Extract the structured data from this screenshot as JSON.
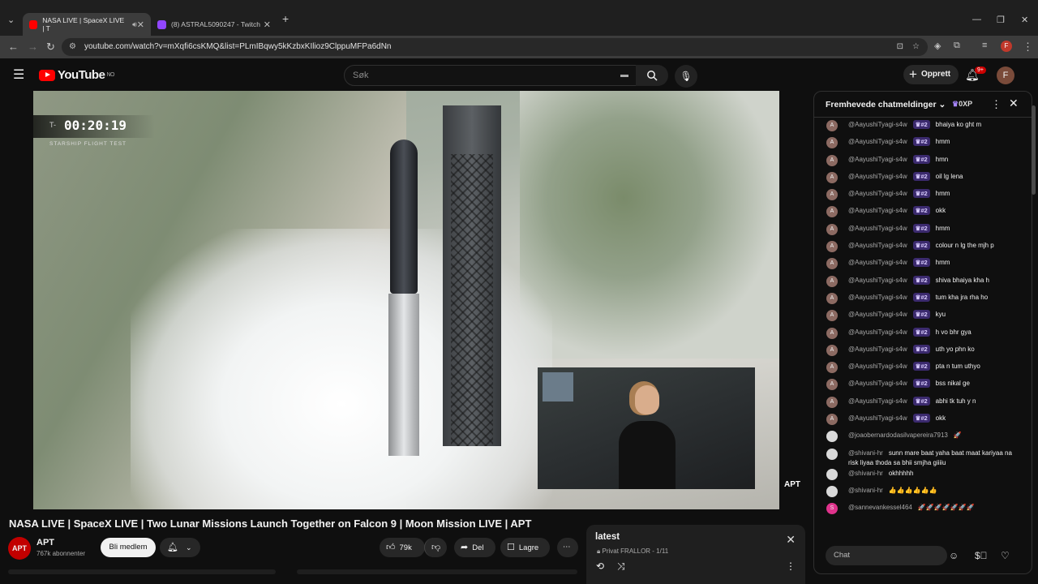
{
  "browser": {
    "tabs": [
      {
        "label": "NASA LIVE | SpaceX LIVE | T"
      },
      {
        "label": "(8) ASTRAL5090247 - Twitch"
      }
    ],
    "url": "youtube.com/watch?v=mXqfi6csKMQ&list=PLmIBqwy5kKzbxKIlioz9ClppuMFPa6dNn"
  },
  "yt": {
    "logo_text": "YouTube",
    "region": "NO",
    "search_placeholder": "Søk",
    "create_label": "Opprett",
    "notif_count": "9+",
    "account_initial": "F"
  },
  "video": {
    "timer_prefix": "T-",
    "timer_value": "00:20:19",
    "timer_sub": "STARSHIP FLIGHT TEST",
    "watermark": "APT",
    "title": "NASA LIVE | SpaceX LIVE | Two Lunar Missions Launch Together on Falcon 9 | Moon Mission LIVE | APT"
  },
  "channel": {
    "avatar_text": "APT",
    "name": "APT",
    "subscribers": "767k abonnenter",
    "join_label": "Bli medlem"
  },
  "actions": {
    "likes": "79k",
    "share": "Del",
    "save": "Lagre"
  },
  "playlist": {
    "title": "latest",
    "subtitle": "Privat FRALLOR - 1/11"
  },
  "chat": {
    "header": "Fremhevede chatmeldinger",
    "xp": "0XP",
    "input_placeholder": "Chat",
    "messages": [
      {
        "av": "A",
        "author": "@AayushiTyagi-s4w",
        "badge": "#2",
        "text": "bhaiya ko ght m"
      },
      {
        "av": "A",
        "author": "@AayushiTyagi-s4w",
        "badge": "#2",
        "text": "hmm"
      },
      {
        "av": "A",
        "author": "@AayushiTyagi-s4w",
        "badge": "#2",
        "text": "hmn"
      },
      {
        "av": "A",
        "author": "@AayushiTyagi-s4w",
        "badge": "#2",
        "text": "oil lg lena"
      },
      {
        "av": "A",
        "author": "@AayushiTyagi-s4w",
        "badge": "#2",
        "text": "hmm"
      },
      {
        "av": "A",
        "author": "@AayushiTyagi-s4w",
        "badge": "#2",
        "text": "okk"
      },
      {
        "av": "A",
        "author": "@AayushiTyagi-s4w",
        "badge": "#2",
        "text": "hmm"
      },
      {
        "av": "A",
        "author": "@AayushiTyagi-s4w",
        "badge": "#2",
        "text": "colour n lg the mjh p"
      },
      {
        "av": "A",
        "author": "@AayushiTyagi-s4w",
        "badge": "#2",
        "text": "hmm"
      },
      {
        "av": "A",
        "author": "@AayushiTyagi-s4w",
        "badge": "#2",
        "text": "shiva bhaiya kha h"
      },
      {
        "av": "A",
        "author": "@AayushiTyagi-s4w",
        "badge": "#2",
        "text": "tum kha jra rha ho"
      },
      {
        "av": "A",
        "author": "@AayushiTyagi-s4w",
        "badge": "#2",
        "text": "kyu"
      },
      {
        "av": "A",
        "author": "@AayushiTyagi-s4w",
        "badge": "#2",
        "text": "h vo bhr gya"
      },
      {
        "av": "A",
        "author": "@AayushiTyagi-s4w",
        "badge": "#2",
        "text": "uth yo phn ko"
      },
      {
        "av": "A",
        "author": "@AayushiTyagi-s4w",
        "badge": "#2",
        "text": "pta n tum uthyo"
      },
      {
        "av": "A",
        "author": "@AayushiTyagi-s4w",
        "badge": "#2",
        "text": "bss nikal ge"
      },
      {
        "av": "A",
        "author": "@AayushiTyagi-s4w",
        "badge": "#2",
        "text": "abhi tk tuh y n"
      },
      {
        "av": "A",
        "author": "@AayushiTyagi-s4w",
        "badge": "#2",
        "text": "okk"
      },
      {
        "av": "",
        "author": "@joaobernardodasilvapereira7913",
        "badge": "",
        "text": "🚀"
      },
      {
        "av": "",
        "author": "@shivani-hr",
        "badge": "",
        "text": "sunn mare baat yaha baat maat kariyaa na risk liyaa thoda sa bhii smjha giiiiu"
      },
      {
        "av": "",
        "author": "@shivani-hr",
        "badge": "",
        "text": "okhhhhh"
      },
      {
        "av": "",
        "author": "@shivani-hr",
        "badge": "",
        "text": "👍👍👍👍👍👍"
      },
      {
        "av": "S",
        "author": "@sannevankessel464",
        "badge": "",
        "text": "🚀🚀🚀🚀🚀🚀🚀"
      }
    ]
  },
  "colors": {
    "brand_red": "#ff0000",
    "bg": "#0f0f0f",
    "badge_purple": "#3b2a6e"
  }
}
